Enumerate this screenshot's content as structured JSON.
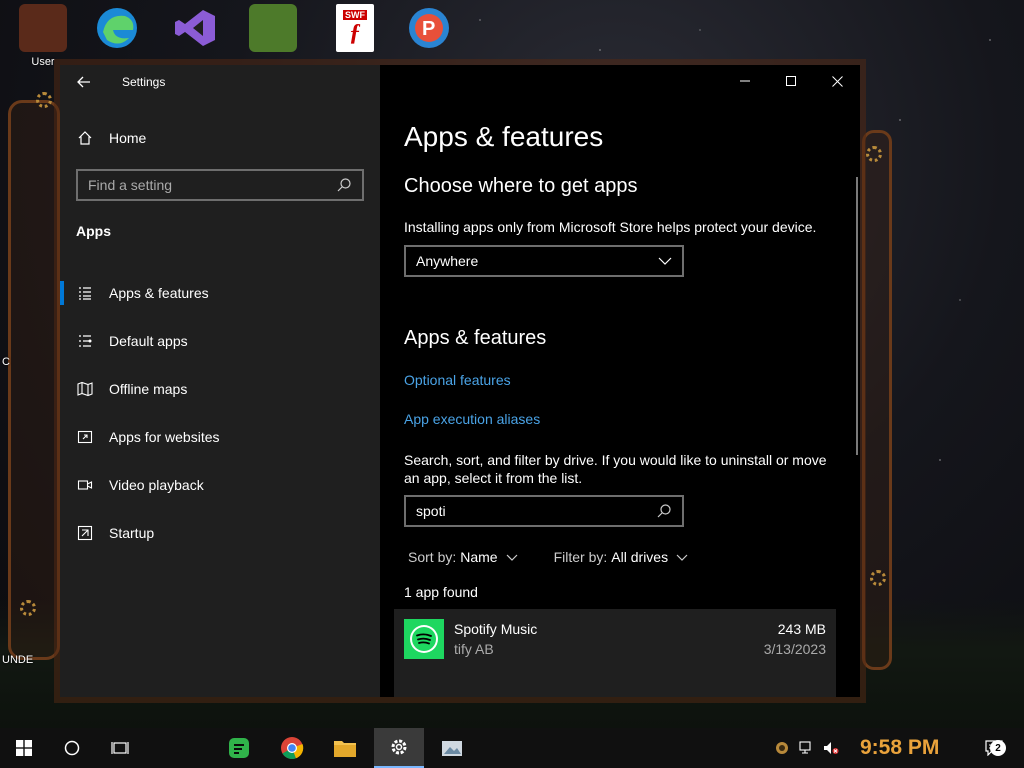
{
  "colors": {
    "accent": "#0078d7",
    "link": "#4aa3e6",
    "spotify": "#1ed760",
    "clock": "#e9a23b"
  },
  "desktop": {
    "icons": [
      {
        "label": "User",
        "icon": "user-folder-icon"
      },
      {
        "label": "",
        "icon": "edge-icon"
      },
      {
        "label": "",
        "icon": "visual-studio-icon"
      },
      {
        "label": "",
        "icon": "minecraft-icon"
      },
      {
        "label": "",
        "icon": "flash-swf-icon"
      },
      {
        "label": "",
        "icon": "paint-icon"
      }
    ],
    "side_labels": [
      "C",
      "UNDE"
    ],
    "flash_badge": "SWF"
  },
  "window": {
    "title": "Settings",
    "sidebar": {
      "home": "Home",
      "search_placeholder": "Find a setting",
      "section": "Apps",
      "items": [
        {
          "label": "Apps & features",
          "icon": "apps-list-icon",
          "active": true
        },
        {
          "label": "Default apps",
          "icon": "default-apps-icon",
          "active": false
        },
        {
          "label": "Offline maps",
          "icon": "map-icon",
          "active": false
        },
        {
          "label": "Apps for websites",
          "icon": "open-in-app-icon",
          "active": false
        },
        {
          "label": "Video playback",
          "icon": "video-icon",
          "active": false
        },
        {
          "label": "Startup",
          "icon": "startup-icon",
          "active": false
        }
      ]
    },
    "main": {
      "title": "Apps & features",
      "choose_heading": "Choose where to get apps",
      "choose_desc": "Installing apps only from Microsoft Store helps protect your device.",
      "source_selected": "Anywhere",
      "features_heading": "Apps & features",
      "optional_link": "Optional features",
      "aliases_link": "App execution aliases",
      "search_desc": "Search, sort, and filter by drive. If you would like to uninstall or move an app, select it from the list.",
      "search_value": "spoti",
      "sort_label": "Sort by:",
      "sort_value": "Name",
      "filter_label": "Filter by:",
      "filter_value": "All drives",
      "found_text": "1 app found",
      "apps": [
        {
          "name": "Spotify Music",
          "publisher": "tify AB",
          "size": "243 MB",
          "date": "3/13/2023"
        }
      ]
    }
  },
  "taskbar": {
    "clock": "9:58 PM",
    "notification_count": "2",
    "apps": [
      "start-icon",
      "cortana-icon",
      "task-view-icon",
      "greenshot-icon",
      "chrome-icon",
      "file-explorer-icon",
      "settings-icon",
      "photos-icon"
    ]
  }
}
